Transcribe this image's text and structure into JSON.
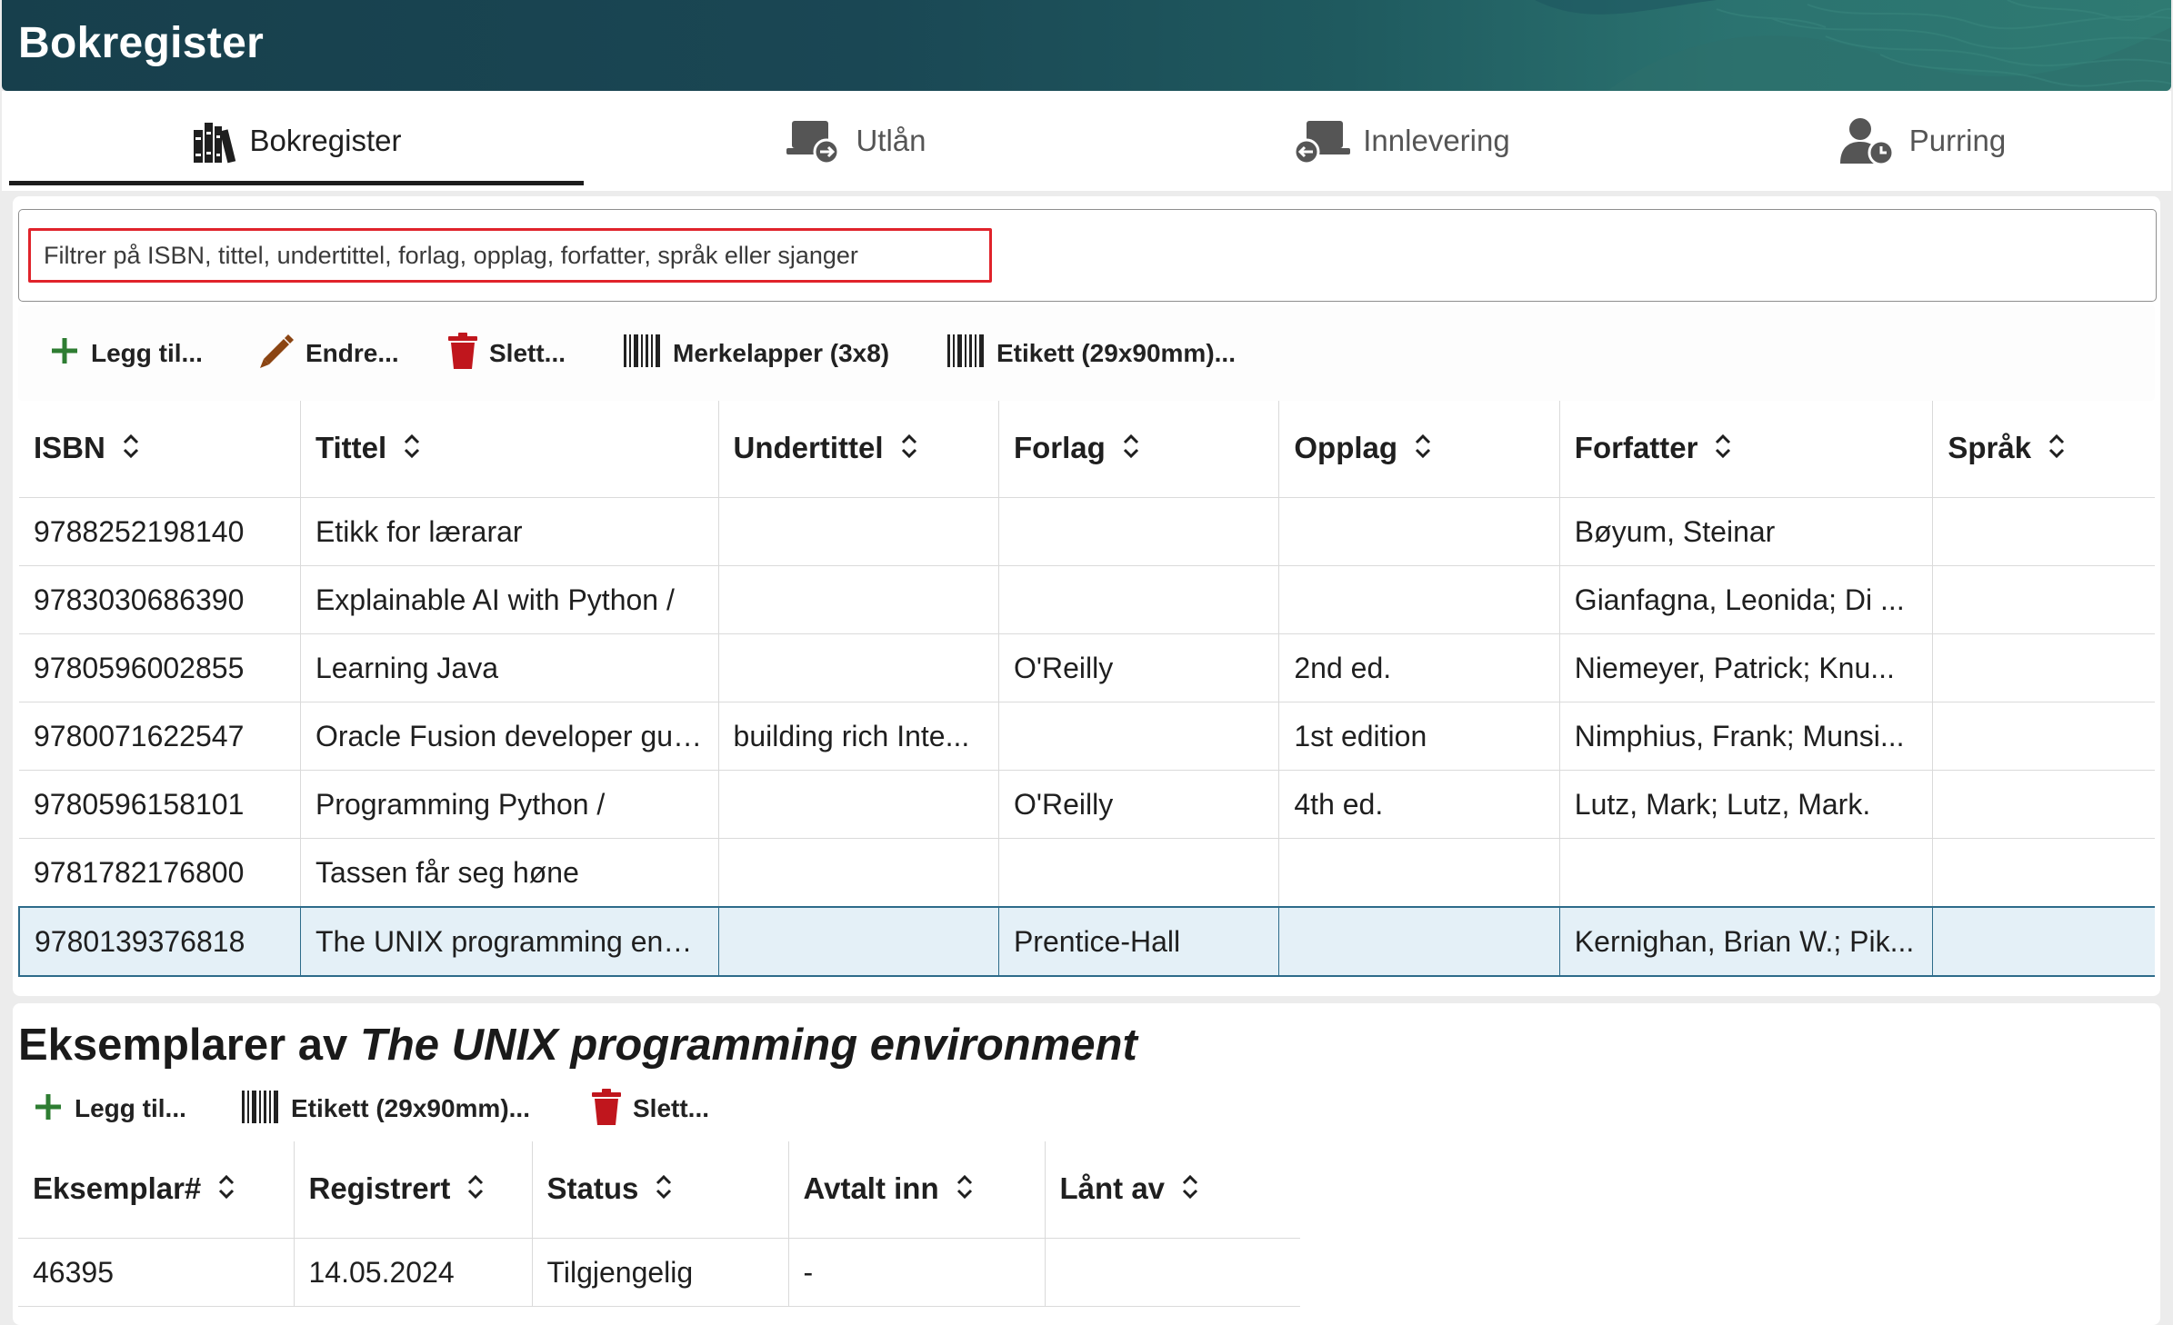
{
  "app": {
    "title": "Bokregister"
  },
  "tabs": [
    {
      "label": "Bokregister",
      "icon": "books-icon",
      "active": true
    },
    {
      "label": "Utlån",
      "icon": "laptop-arrow-out-icon",
      "active": false
    },
    {
      "label": "Innlevering",
      "icon": "laptop-arrow-in-icon",
      "active": false
    },
    {
      "label": "Purring",
      "icon": "user-clock-icon",
      "active": false
    }
  ],
  "filter": {
    "placeholder": "Filtrer på ISBN, tittel, undertittel, forlag, opplag, forfatter, språk eller sjanger",
    "value": ""
  },
  "toolbar": {
    "add": "Legg til...",
    "edit": "Endre...",
    "delete": "Slett...",
    "labels": "Merkelapper (3x8)",
    "label_single": "Etikett (29x90mm)..."
  },
  "books": {
    "columns": [
      "ISBN",
      "Tittel",
      "Undertittel",
      "Forlag",
      "Opplag",
      "Forfatter",
      "Språk"
    ],
    "rows": [
      [
        "9788252198140",
        "Etikk for lærarar",
        "",
        "",
        "",
        "Bøyum, Steinar",
        ""
      ],
      [
        "9783030686390",
        "Explainable AI with Python /",
        "",
        "",
        "",
        "Gianfagna, Leonida; Di ...",
        ""
      ],
      [
        "9780596002855",
        "Learning Java",
        "",
        "O'Reilly",
        "2nd ed.",
        "Niemeyer, Patrick; Knu...",
        ""
      ],
      [
        "9780071622547",
        "Oracle Fusion developer guide",
        "building rich Inte...",
        "",
        "1st edition",
        "Nimphius, Frank; Munsi...",
        ""
      ],
      [
        "9780596158101",
        "Programming Python /",
        "",
        "O'Reilly",
        "4th ed.",
        "Lutz, Mark; Lutz, Mark.",
        ""
      ],
      [
        "9781782176800",
        "Tassen får seg høne",
        "",
        "",
        "",
        "",
        ""
      ],
      [
        "9780139376818",
        "The UNIX programming enviro...",
        "",
        "Prentice-Hall",
        "",
        "Kernighan, Brian W.; Pik...",
        ""
      ]
    ],
    "selected_row": 6
  },
  "copies_section": {
    "title_prefix": "Eksemplarer av",
    "title_book": "The UNIX programming environment",
    "toolbar": {
      "add": "Legg til...",
      "label": "Etikett (29x90mm)...",
      "delete": "Slett..."
    },
    "columns": [
      "Eksemplar#",
      "Registrert",
      "Status",
      "Avtalt inn",
      "Lånt av"
    ],
    "rows": [
      [
        "46395",
        "14.05.2024",
        "Tilgjengelig",
        "-",
        ""
      ]
    ]
  },
  "colors": {
    "header_bg": "#1a4754",
    "accent_add": "#2e7d32",
    "accent_edit": "#8b4513",
    "accent_delete": "#c0161d",
    "selected_row_bg": "#e4f0f7",
    "status_available": "#3d6b1d",
    "filter_highlight": "#e0232b"
  }
}
